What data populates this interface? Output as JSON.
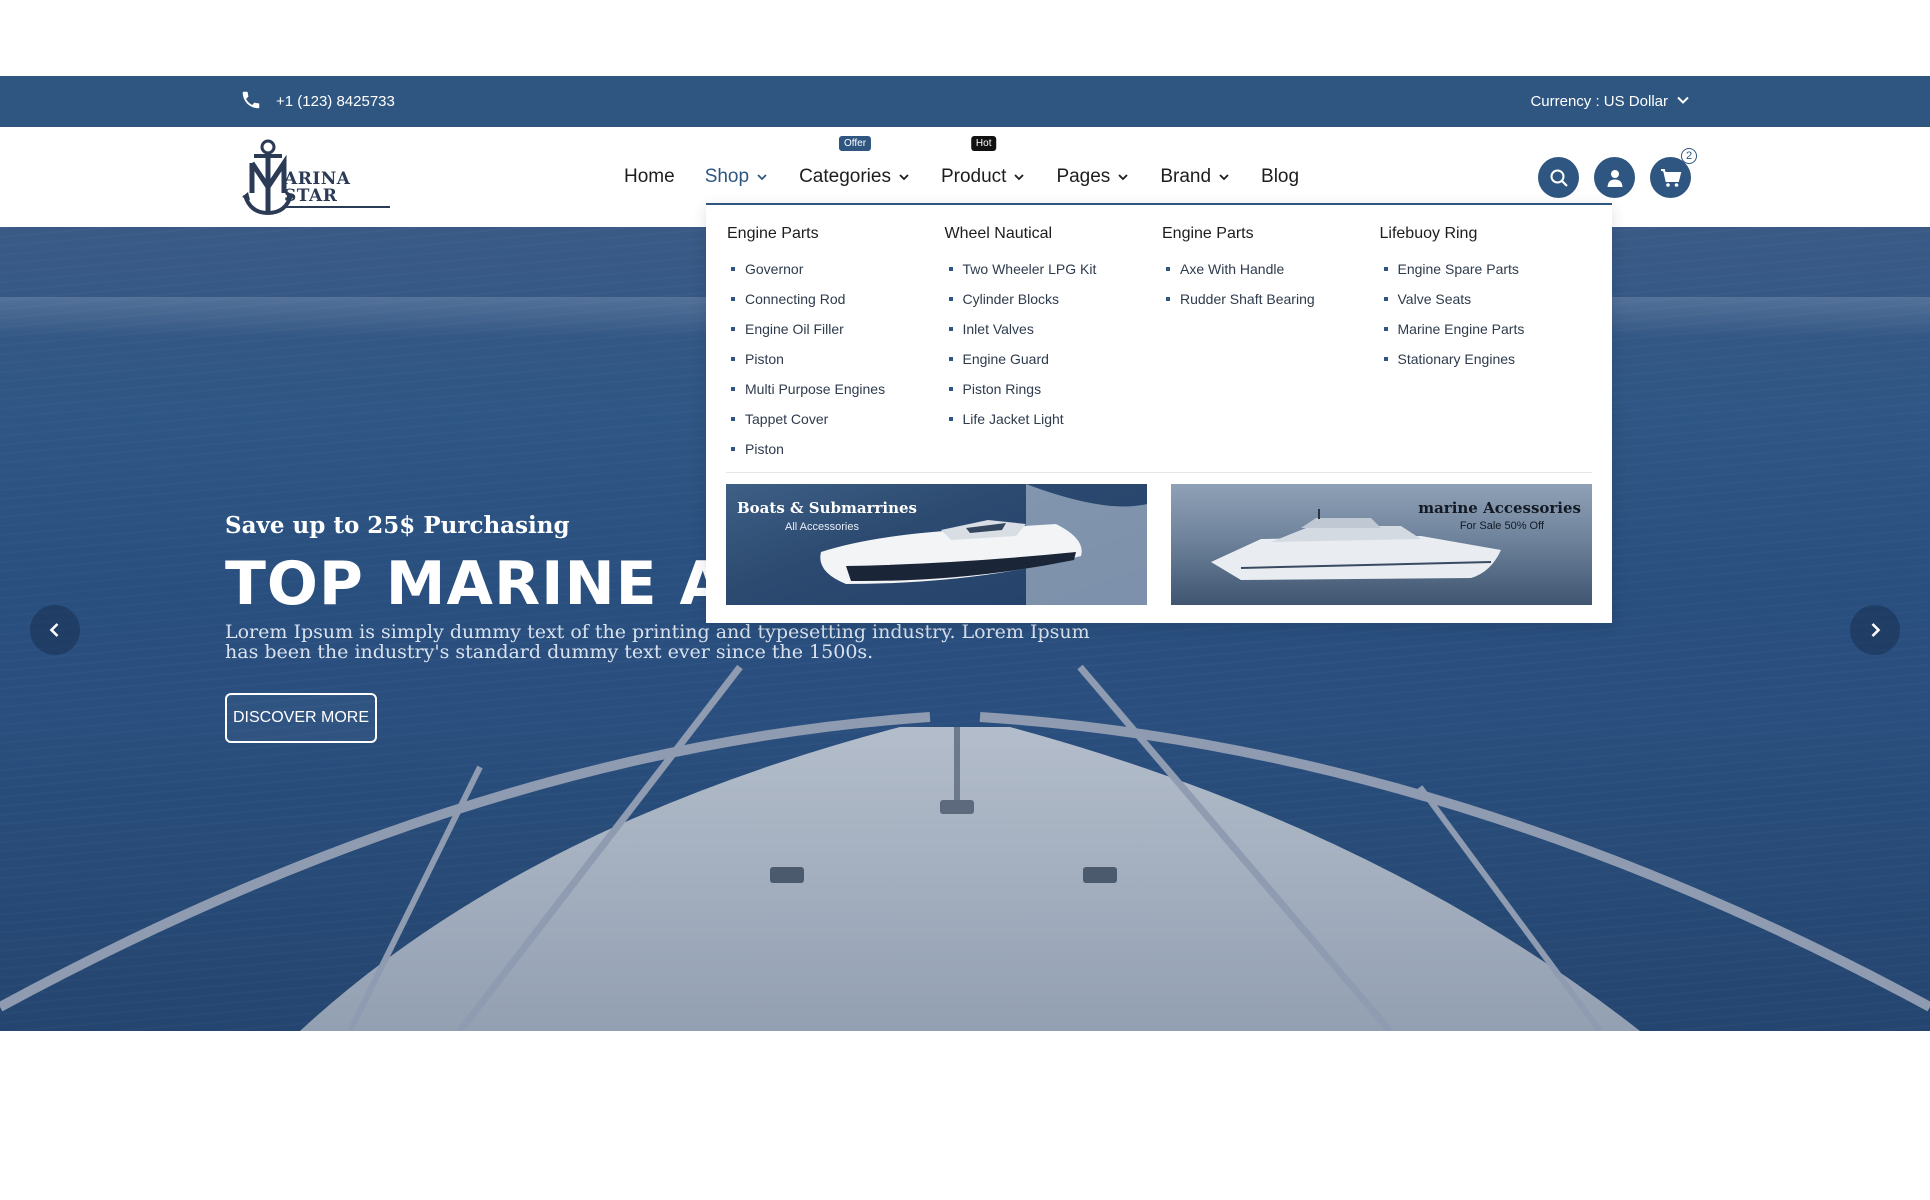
{
  "topbar": {
    "phone": "+1 (123) 8425733",
    "currency": "Currency : US Dollar",
    "icons": [
      "phone-icon",
      "chevron-down-icon"
    ]
  },
  "header": {
    "logo_text": "ARINA STAR",
    "nav": [
      {
        "label": "Home",
        "has_dropdown": false,
        "badge": ""
      },
      {
        "label": "Shop",
        "has_dropdown": true,
        "badge": "",
        "active": true
      },
      {
        "label": "Categories",
        "has_dropdown": true,
        "badge": "Offer"
      },
      {
        "label": "Product",
        "has_dropdown": true,
        "badge": "Hot"
      },
      {
        "label": "Pages",
        "has_dropdown": true,
        "badge": ""
      },
      {
        "label": "Brand",
        "has_dropdown": true,
        "badge": ""
      },
      {
        "label": "Blog",
        "has_dropdown": false,
        "badge": ""
      }
    ],
    "cart_count": "2",
    "icons": [
      "search-icon",
      "user-icon",
      "cart-icon"
    ]
  },
  "mega_menu": {
    "columns": [
      {
        "title": "Engine Parts",
        "items": [
          "Governor",
          "Connecting Rod",
          "Engine Oil Filler",
          "Piston",
          "Multi Purpose Engines",
          "Tappet Cover",
          "Piston"
        ]
      },
      {
        "title": "Wheel Nautical",
        "items": [
          "Two Wheeler LPG Kit",
          "Cylinder Blocks",
          "Inlet Valves",
          "Engine Guard",
          "Piston Rings",
          "Life Jacket Light"
        ]
      },
      {
        "title": "Engine Parts",
        "items": [
          "Axe With Handle",
          "Rudder Shaft Bearing"
        ]
      },
      {
        "title": "Lifebuoy Ring",
        "items": [
          "Engine Spare Parts",
          "Valve Seats",
          "Marine Engine Parts",
          "Stationary Engines"
        ]
      }
    ],
    "promos": [
      {
        "title": "Boats & Submarrines",
        "subtitle": "All Accessories"
      },
      {
        "title": "marine Accessories",
        "subtitle": "For Sale 50% Off"
      }
    ]
  },
  "hero": {
    "subtitle": "Save up to 25$ Purchasing",
    "title": "TOP MARINE ACCESSORIES",
    "description": "Lorem Ipsum is simply dummy text of the printing and typesetting industry. Lorem Ipsum has been the industry's standard dummy text ever since the 1500s.",
    "button": "DISCOVER MORE",
    "icons": [
      "chevron-left-icon",
      "chevron-right-icon"
    ]
  },
  "colors": {
    "primary": "#2e5680",
    "hero_sea": "#2a4f7e",
    "hot_badge": "#111111"
  }
}
